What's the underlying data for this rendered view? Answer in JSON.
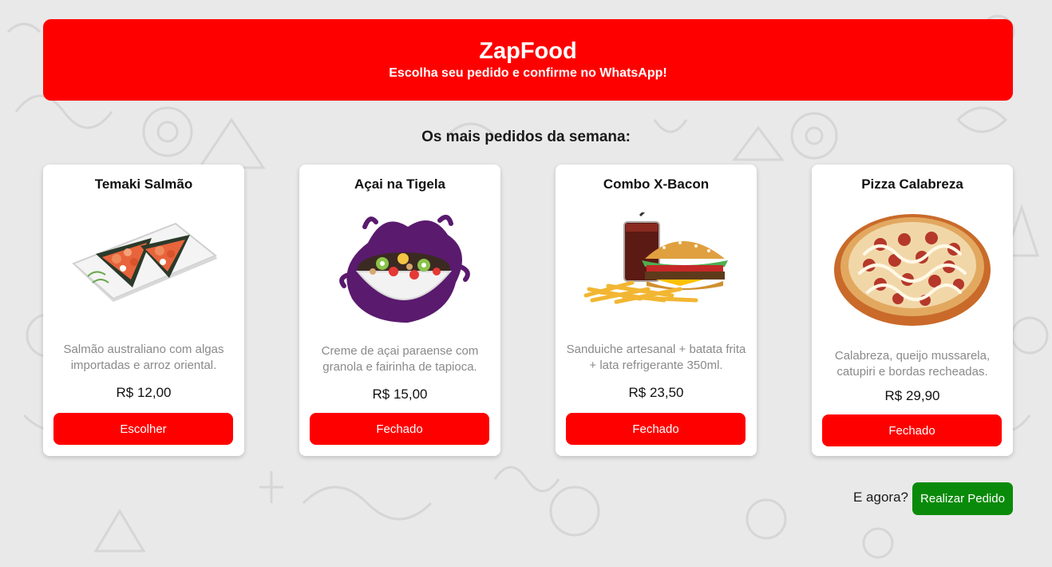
{
  "header": {
    "title": "ZapFood",
    "subtitle": "Escolha seu pedido e confirme no WhatsApp!"
  },
  "section_title": "Os mais pedidos da semana:",
  "products": [
    {
      "name": "Temaki Salmão",
      "image": "temaki-image",
      "description": "Salmão australiano com algas importadas e arroz oriental.",
      "price": "R$ 12,00",
      "button": "Escolher"
    },
    {
      "name": "Açai na Tigela",
      "image": "acai-bowl-image",
      "description": "Creme de açai paraense com granola e fairinha de tapioca.",
      "price": "R$ 15,00",
      "button": "Fechado"
    },
    {
      "name": "Combo X-Bacon",
      "image": "burger-combo-image",
      "description": "Sanduiche artesanal + batata frita + lata refrigerante 350ml.",
      "price": "R$ 23,50",
      "button": "Fechado"
    },
    {
      "name": "Pizza Calabreza",
      "image": "pizza-image",
      "description": "Calabreza, queijo mussarela, catupiri e bordas recheadas.",
      "price": "R$ 29,90",
      "button": "Fechado"
    }
  ],
  "footer": {
    "question": "E agora?",
    "order_button": "Realizar Pedido"
  },
  "colors": {
    "brand": "#ff0000",
    "order": "#0a8a0a",
    "background": "#e9e9e9"
  }
}
